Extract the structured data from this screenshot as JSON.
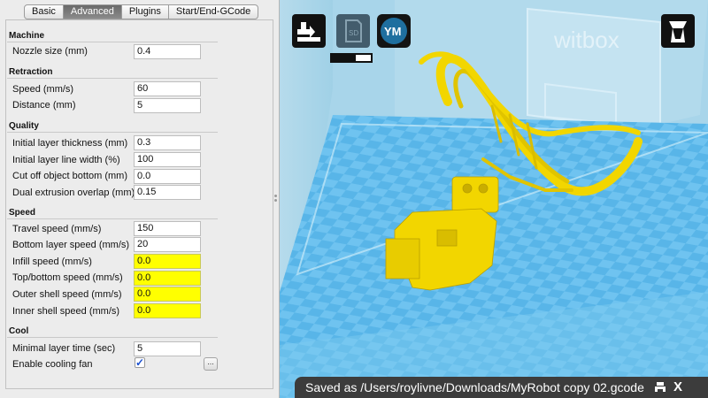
{
  "tabs": [
    "Basic",
    "Advanced",
    "Plugins",
    "Start/End-GCode"
  ],
  "active_tab": "Advanced",
  "sections": {
    "machine": {
      "title": "Machine",
      "fields": [
        {
          "label": "Nozzle size (mm)",
          "value": "0.4"
        }
      ]
    },
    "retraction": {
      "title": "Retraction",
      "fields": [
        {
          "label": "Speed (mm/s)",
          "value": "60"
        },
        {
          "label": "Distance (mm)",
          "value": "5"
        }
      ]
    },
    "quality": {
      "title": "Quality",
      "fields": [
        {
          "label": "Initial layer thickness (mm)",
          "value": "0.3"
        },
        {
          "label": "Initial layer line width (%)",
          "value": "100"
        },
        {
          "label": "Cut off object bottom (mm)",
          "value": "0.0"
        },
        {
          "label": "Dual extrusion overlap (mm)",
          "value": "0.15"
        }
      ]
    },
    "speed": {
      "title": "Speed",
      "fields": [
        {
          "label": "Travel speed (mm/s)",
          "value": "150"
        },
        {
          "label": "Bottom layer speed (mm/s)",
          "value": "20"
        },
        {
          "label": "Infill speed (mm/s)",
          "value": "0.0"
        },
        {
          "label": "Top/bottom speed (mm/s)",
          "value": "0.0"
        },
        {
          "label": "Outer shell speed (mm/s)",
          "value": "0.0"
        },
        {
          "label": "Inner shell speed (mm/s)",
          "value": "0.0"
        }
      ]
    },
    "cool": {
      "title": "Cool",
      "fields": [
        {
          "label": "Minimal layer time (sec)",
          "value": "5"
        }
      ],
      "cooling_fan_label": "Enable cooling fan",
      "cooling_fan_checked": true,
      "more_button": "..."
    }
  },
  "viewport": {
    "sd_icon_label": "SD",
    "ym_button_label": "YM",
    "brand": "witbox",
    "progress": 0.62,
    "status_message": "Saved as /Users/roylivne/Downloads/MyRobot copy 02.gcode",
    "close_label": "X",
    "model_color": "#f2d600",
    "bed_color": "#6fc3f0",
    "warning_field_color": "#ffff00"
  },
  "icons": [
    "load-model-icon",
    "sd-card-icon",
    "ym-logo-icon",
    "view-mode-icon",
    "print-icon",
    "close-icon"
  ]
}
